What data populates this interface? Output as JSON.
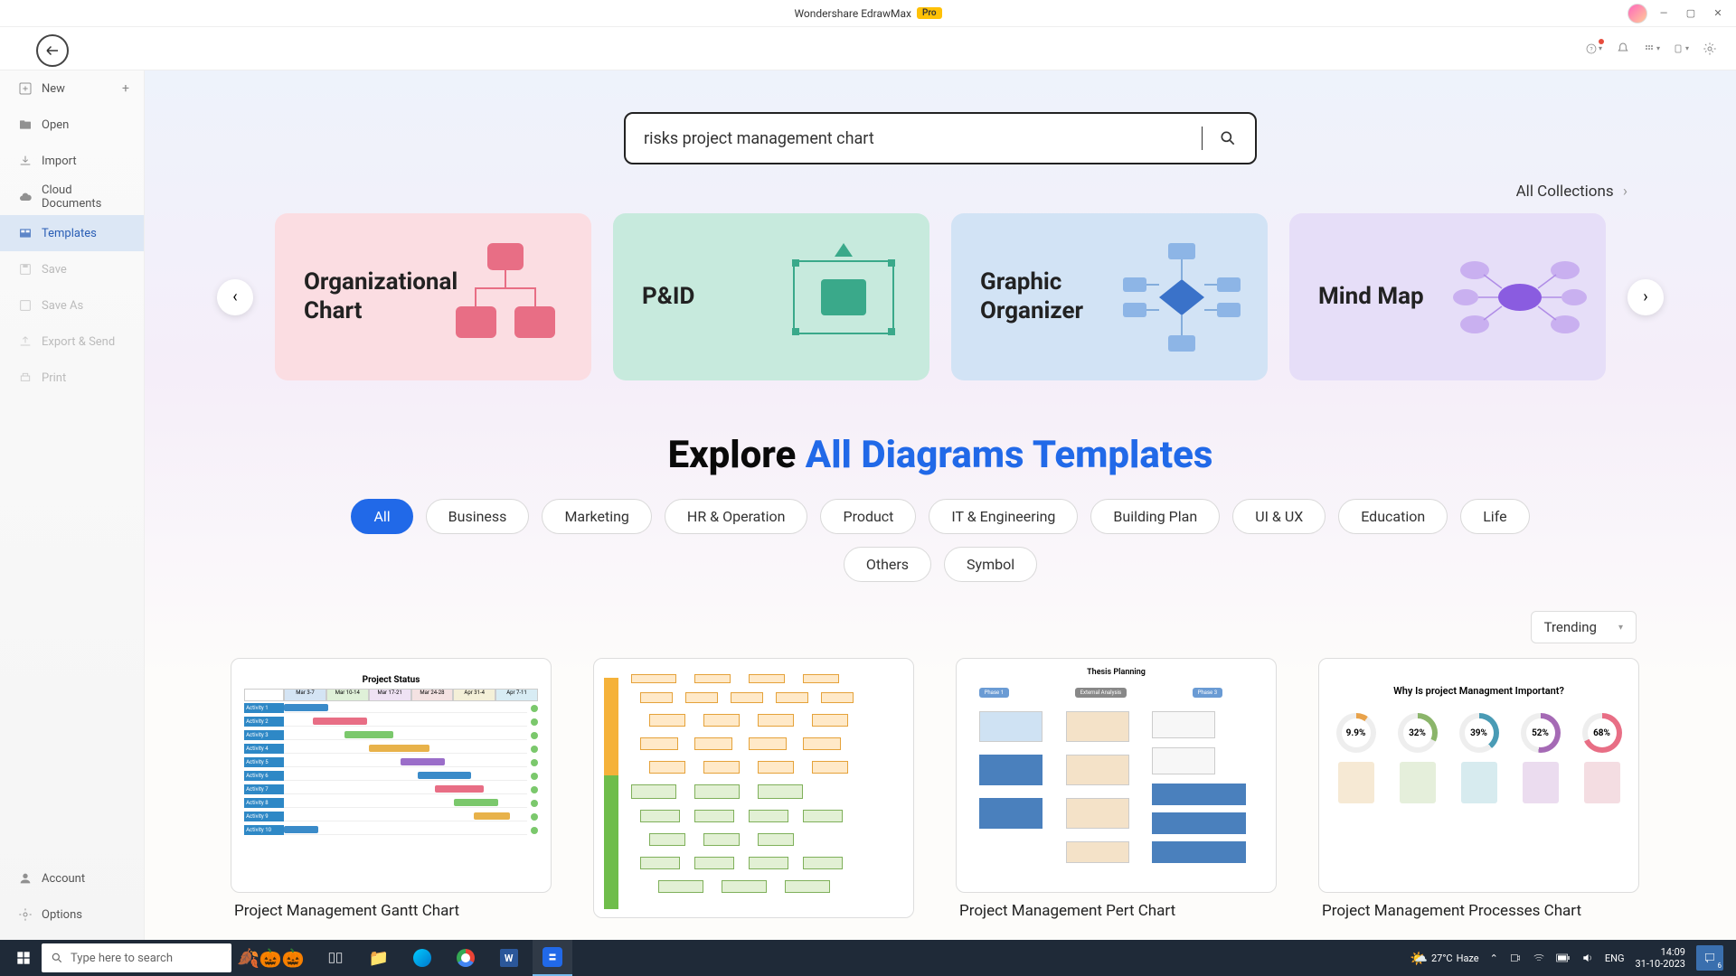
{
  "titlebar": {
    "app_name": "Wondershare EdrawMax",
    "badge": "Pro"
  },
  "sidebar": {
    "items": [
      {
        "label": "New",
        "icon": "plus-square",
        "has_add": true
      },
      {
        "label": "Open",
        "icon": "folder"
      },
      {
        "label": "Import",
        "icon": "download"
      },
      {
        "label": "Cloud Documents",
        "icon": "cloud"
      },
      {
        "label": "Templates",
        "icon": "template",
        "active": true
      },
      {
        "label": "Save",
        "icon": "save",
        "disabled": true
      },
      {
        "label": "Save As",
        "icon": "save-as",
        "disabled": true
      },
      {
        "label": "Export & Send",
        "icon": "export",
        "disabled": true
      },
      {
        "label": "Print",
        "icon": "print",
        "disabled": true
      }
    ],
    "bottom": [
      {
        "label": "Account",
        "icon": "account"
      },
      {
        "label": "Options",
        "icon": "gear"
      }
    ]
  },
  "search": {
    "value": "risks project management chart"
  },
  "all_collections_label": "All Collections",
  "categories": [
    {
      "label": "Organizational Chart",
      "color": "pink"
    },
    {
      "label": "P&ID",
      "color": "green"
    },
    {
      "label": "Graphic Organizer",
      "color": "blue"
    },
    {
      "label": "Mind Map",
      "color": "purple"
    }
  ],
  "explore": {
    "prefix": "Explore ",
    "accent": "All Diagrams Templates"
  },
  "filters": [
    "All",
    "Business",
    "Marketing",
    "HR & Operation",
    "Product",
    "IT & Engineering",
    "Building Plan",
    "UI & UX",
    "Education",
    "Life",
    "Others",
    "Symbol"
  ],
  "active_filter": "All",
  "sort": {
    "label": "Trending"
  },
  "templates": [
    {
      "title": "Project Management Gantt Chart",
      "thumb": "gantt"
    },
    {
      "title": "",
      "thumb": "flow"
    },
    {
      "title": "Project Management Pert Chart",
      "thumb": "pert"
    },
    {
      "title": "Project Management Processes Chart",
      "thumb": "donut"
    }
  ],
  "thumb_gantt": {
    "title": "Project Status",
    "cols": [
      "Mar 3-7",
      "Mar 10-14",
      "Mar 17-21",
      "Mar 24-28",
      "Apr 31-4",
      "Apr 7-11"
    ]
  },
  "thumb_pert": {
    "title": "Thesis Planning"
  },
  "thumb_donut": {
    "title": "Why Is project Managment Important?",
    "values": [
      "9.9%",
      "32%",
      "39%",
      "52%",
      "68%"
    ]
  },
  "taskbar": {
    "search_placeholder": "Type here to search",
    "weather_temp": "27°C",
    "weather_desc": "Haze",
    "lang": "ENG",
    "time": "14:09",
    "date": "31-10-2023",
    "notif_count": "6"
  }
}
